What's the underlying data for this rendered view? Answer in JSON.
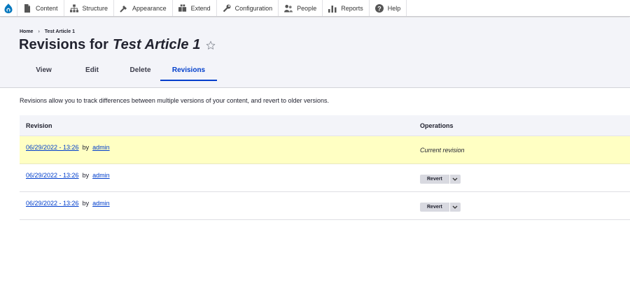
{
  "toolbar": {
    "items": [
      {
        "label": "Content",
        "icon": "content-icon"
      },
      {
        "label": "Structure",
        "icon": "structure-icon"
      },
      {
        "label": "Appearance",
        "icon": "appearance-icon"
      },
      {
        "label": "Extend",
        "icon": "extend-icon"
      },
      {
        "label": "Configuration",
        "icon": "configuration-icon"
      },
      {
        "label": "People",
        "icon": "people-icon"
      },
      {
        "label": "Reports",
        "icon": "reports-icon"
      },
      {
        "label": "Help",
        "icon": "help-icon"
      }
    ],
    "logo_icon": "drupal-logo-icon",
    "accent_color": "#003ecc"
  },
  "breadcrumb": {
    "home": "Home",
    "separator": "›",
    "current": "Test Article 1"
  },
  "page": {
    "title_prefix": "Revisions for",
    "title_node": "Test Article 1",
    "description": "Revisions allow you to track differences between multiple versions of your content, and revert to older versions."
  },
  "tabs": [
    {
      "label": "View",
      "active": false
    },
    {
      "label": "Edit",
      "active": false
    },
    {
      "label": "Delete",
      "active": false
    },
    {
      "label": "Revisions",
      "active": true
    }
  ],
  "table": {
    "headers": {
      "revision": "Revision",
      "operations": "Operations"
    },
    "rows": [
      {
        "date": "06/29/2022 - 13:26",
        "by": "by",
        "author": "admin",
        "operation": "Current revision",
        "current": true
      },
      {
        "date": "06/29/2022 - 13:26",
        "by": "by",
        "author": "admin",
        "operation": "Revert",
        "current": false
      },
      {
        "date": "06/29/2022 - 13:26",
        "by": "by",
        "author": "admin",
        "operation": "Revert",
        "current": false
      }
    ],
    "current_row_color": "#ffffc3"
  }
}
